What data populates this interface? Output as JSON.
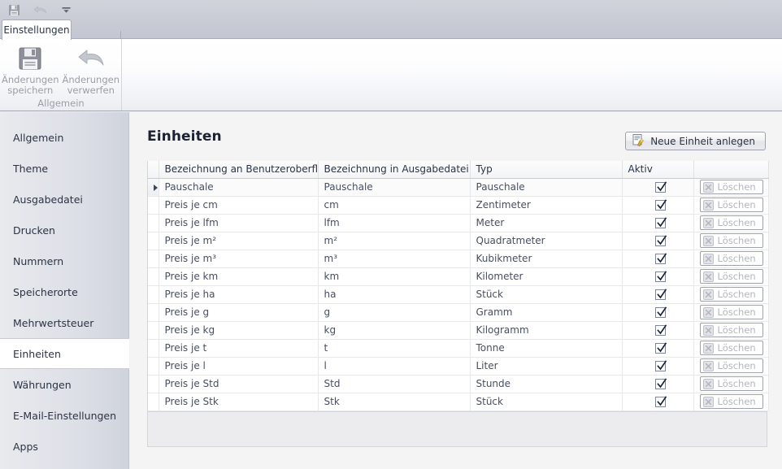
{
  "window": {
    "quick_access": [
      {
        "name": "save-icon",
        "label": "Speichern",
        "enabled": true
      },
      {
        "name": "undo-icon",
        "label": "Rückgängig",
        "enabled": false
      },
      {
        "name": "chevron-down-icon",
        "label": "Schnellzugriff anpassen",
        "enabled": true
      }
    ]
  },
  "ribbon": {
    "tabs": [
      {
        "label": "Einstellungen",
        "active": true
      }
    ],
    "group": {
      "caption": "Allgemein",
      "buttons": [
        {
          "icon": "floppy-disk-icon",
          "line1": "Änderungen",
          "line2": "speichern"
        },
        {
          "icon": "undo-arrow-icon",
          "line1": "Änderungen",
          "line2": "verwerfen"
        }
      ]
    }
  },
  "sidebar": {
    "items": [
      {
        "label": "Allgemein",
        "selected": false
      },
      {
        "label": "Theme",
        "selected": false
      },
      {
        "label": "Ausgabedatei",
        "selected": false
      },
      {
        "label": "Drucken",
        "selected": false
      },
      {
        "label": "Nummern",
        "selected": false
      },
      {
        "label": "Speicherorte",
        "selected": false
      },
      {
        "label": "Mehrwertsteuer",
        "selected": false
      },
      {
        "label": "Einheiten",
        "selected": true
      },
      {
        "label": "Währungen",
        "selected": false
      },
      {
        "label": "E-Mail-Einstellungen",
        "selected": false
      },
      {
        "label": "Apps",
        "selected": false
      }
    ]
  },
  "main": {
    "title": "Einheiten",
    "new_button": {
      "label": "Neue Einheit anlegen",
      "icon": "new-item-wizard-icon"
    },
    "table": {
      "columns": [
        "Bezeichnung an Benutzeroberfläche",
        "Bezeichnung in Ausgabedatei",
        "Typ",
        "Aktiv",
        ""
      ],
      "delete_label": "Löschen",
      "rows": [
        {
          "ui_name": "Pauschale",
          "out_name": "Pauschale",
          "typ": "Pauschale",
          "aktiv": true,
          "current": true
        },
        {
          "ui_name": "Preis je cm",
          "out_name": "cm",
          "typ": "Zentimeter",
          "aktiv": true,
          "current": false
        },
        {
          "ui_name": "Preis je lfm",
          "out_name": "lfm",
          "typ": "Meter",
          "aktiv": true,
          "current": false
        },
        {
          "ui_name": "Preis je m²",
          "out_name": "m²",
          "typ": "Quadratmeter",
          "aktiv": true,
          "current": false
        },
        {
          "ui_name": "Preis je m³",
          "out_name": "m³",
          "typ": "Kubikmeter",
          "aktiv": true,
          "current": false
        },
        {
          "ui_name": "Preis je km",
          "out_name": "km",
          "typ": "Kilometer",
          "aktiv": true,
          "current": false
        },
        {
          "ui_name": "Preis je ha",
          "out_name": "ha",
          "typ": "Stück",
          "aktiv": true,
          "current": false
        },
        {
          "ui_name": "Preis je g",
          "out_name": "g",
          "typ": "Gramm",
          "aktiv": true,
          "current": false
        },
        {
          "ui_name": "Preis je kg",
          "out_name": "kg",
          "typ": "Kilogramm",
          "aktiv": true,
          "current": false
        },
        {
          "ui_name": "Preis je t",
          "out_name": "t",
          "typ": "Tonne",
          "aktiv": true,
          "current": false
        },
        {
          "ui_name": "Preis je l",
          "out_name": "l",
          "typ": "Liter",
          "aktiv": true,
          "current": false
        },
        {
          "ui_name": "Preis je Std",
          "out_name": "Std",
          "typ": "Stunde",
          "aktiv": true,
          "current": false
        },
        {
          "ui_name": "Preis je Stk",
          "out_name": "Stk",
          "typ": "Stück",
          "aktiv": true,
          "current": false
        }
      ]
    }
  },
  "colors": {
    "titlebar": "#c9ccd5",
    "sidebar": "#dcdfe6",
    "content_bg": "#f4f4f5",
    "text": "#2b3346",
    "disabled_text": "#9b9ea8"
  }
}
